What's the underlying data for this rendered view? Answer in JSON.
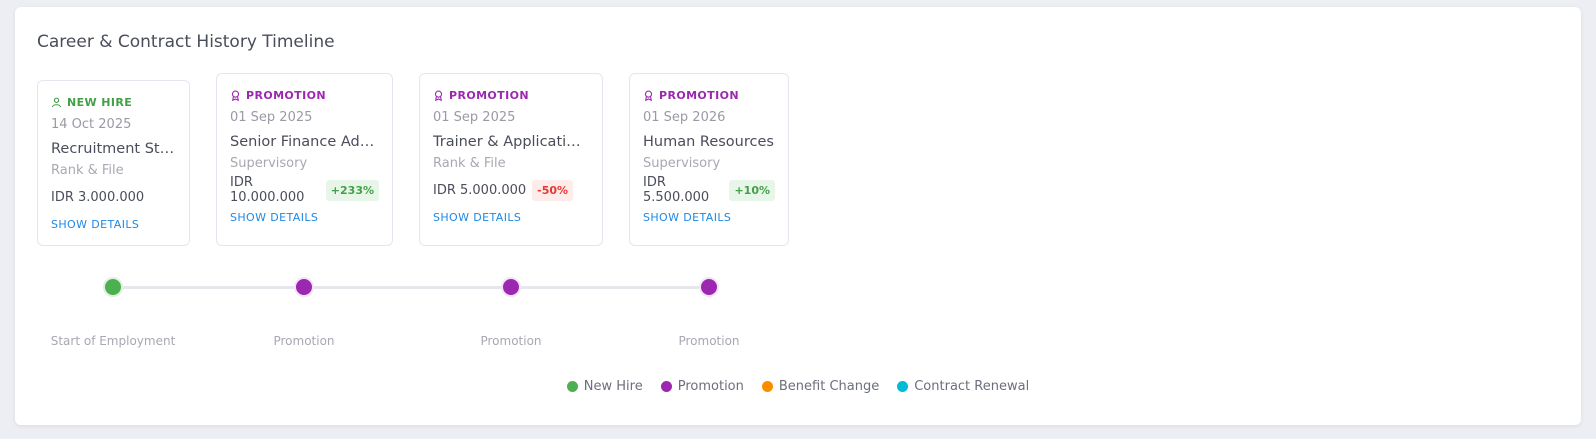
{
  "title": "Career & Contract History Timeline",
  "colors": {
    "new_hire": "#4caf50",
    "promotion": "#9c27b0",
    "benefit_change": "#fb8c00",
    "contract_renewal": "#00bcd4"
  },
  "events": [
    {
      "type": "NEW HIRE",
      "icon": "user-icon",
      "date": "14 Oct 2025",
      "role": "Recruitment Staff",
      "level": "Rank & File",
      "salary": "IDR 3.000.000",
      "change": "",
      "details": "SHOW DETAILS",
      "timeline_label": "Start of Employment"
    },
    {
      "type": "PROMOTION",
      "icon": "award-icon",
      "date": "01 Sep 2025",
      "role": "Senior Finance Admin",
      "level": "Supervisory",
      "salary": "IDR 10.000.000",
      "change": "+233%",
      "details": "SHOW DETAILS",
      "timeline_label": "Promotion"
    },
    {
      "type": "PROMOTION",
      "icon": "award-icon",
      "date": "01 Sep 2025",
      "role": "Trainer & Application Specialist",
      "level": "Rank & File",
      "salary": "IDR 5.000.000",
      "change": "-50%",
      "details": "SHOW DETAILS",
      "timeline_label": "Promotion"
    },
    {
      "type": "PROMOTION",
      "icon": "award-icon",
      "date": "01 Sep 2026",
      "role": "Human Resources",
      "level": "Supervisory",
      "salary": "IDR 5.500.000",
      "change": "+10%",
      "details": "SHOW DETAILS",
      "timeline_label": "Promotion"
    }
  ],
  "legend": [
    {
      "label": "New Hire",
      "color": "#4caf50"
    },
    {
      "label": "Promotion",
      "color": "#9c27b0"
    },
    {
      "label": "Benefit Change",
      "color": "#fb8c00"
    },
    {
      "label": "Contract Renewal",
      "color": "#00bcd4"
    }
  ]
}
